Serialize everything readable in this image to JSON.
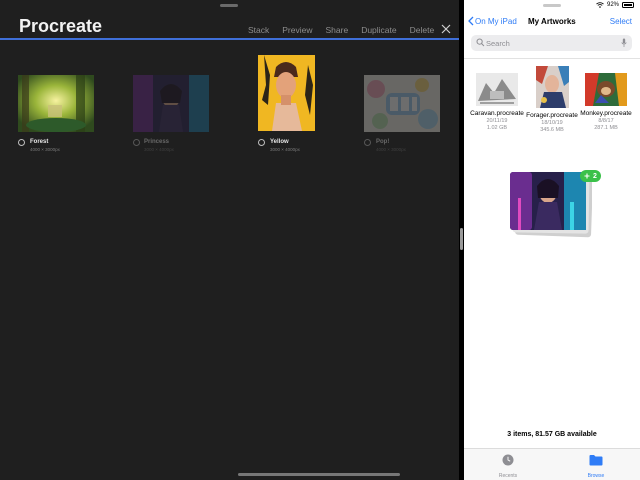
{
  "procreate": {
    "title": "Procreate",
    "toolbar": [
      "Stack",
      "Preview",
      "Share",
      "Duplicate",
      "Delete"
    ],
    "artworks": [
      {
        "name": "Forest",
        "size": "4000 × 3000px",
        "selected": false,
        "dimmed": false
      },
      {
        "name": "Princess",
        "size": "3000 × 4000px",
        "selected": false,
        "dimmed": true
      },
      {
        "name": "Yellow",
        "size": "3000 × 4000px",
        "selected": false,
        "dimmed": false
      },
      {
        "name": "Pop!",
        "size": "4000 × 3000px",
        "selected": false,
        "dimmed": true
      }
    ]
  },
  "status": {
    "battery": "92%"
  },
  "files": {
    "back_label": "On My iPad",
    "title": "My Artworks",
    "select_label": "Select",
    "search_placeholder": "Search",
    "items": [
      {
        "name": "Caravan.procreate",
        "date": "20/11/19",
        "size": "1.02 GB"
      },
      {
        "name": "Forager.procreate",
        "date": "18/10/19",
        "size": "345.6 MB"
      },
      {
        "name": "Monkey.procreate",
        "date": "8/8/17",
        "size": "287.1 MB"
      }
    ],
    "drag_badge": "2",
    "storage": "3 items, 81.57 GB available",
    "tabs": {
      "recents": "Recents",
      "browse": "Browse"
    }
  },
  "colors": {
    "accent": "#3f6fd8",
    "link": "#2f7cf6",
    "badge": "#3bc14a"
  }
}
